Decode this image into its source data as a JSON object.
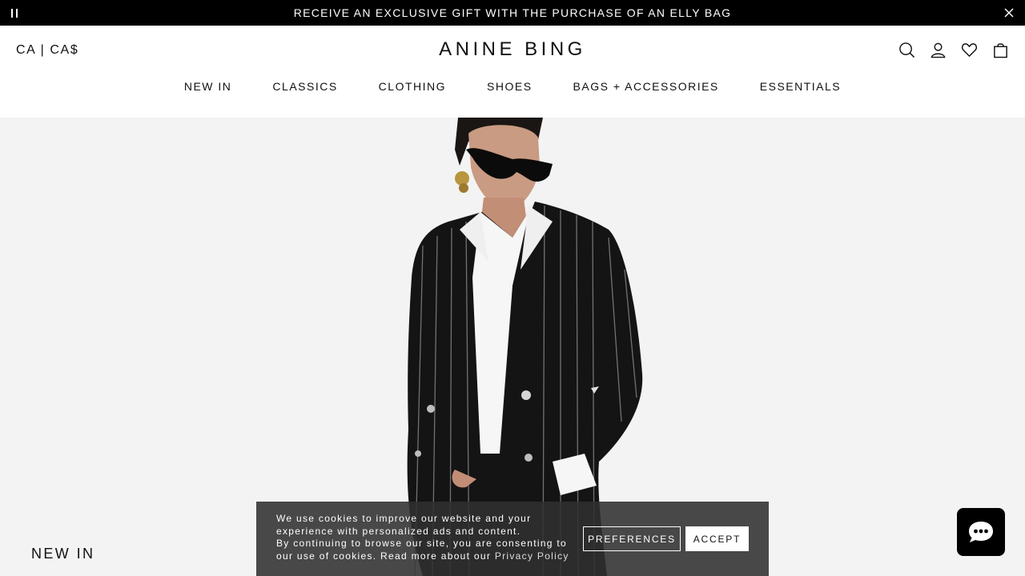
{
  "announcement": {
    "message": "RECEIVE AN EXCLUSIVE GIFT WITH THE PURCHASE OF AN ELLY BAG",
    "pause_icon": "pause-icon",
    "close_icon": "close-icon"
  },
  "header": {
    "locale": "CA | CA$",
    "logo": "ANINE BING",
    "icons": [
      "search-icon",
      "account-icon",
      "wishlist-heart-icon",
      "shopping-bag-icon"
    ]
  },
  "nav": {
    "items": [
      {
        "label": "NEW IN"
      },
      {
        "label": "CLASSICS"
      },
      {
        "label": "CLOTHING"
      },
      {
        "label": "SHOES"
      },
      {
        "label": "BAGS + ACCESSORIES"
      },
      {
        "label": "ESSENTIALS"
      }
    ]
  },
  "hero": {
    "title": "NEW IN",
    "background": "#f3f3f3"
  },
  "cookie": {
    "line1": "We use cookies to improve our website and your",
    "line2": "experience with personalized ads and content.",
    "line3": "By continuing to browse our site, you are consenting to",
    "line4": "our use of cookies. Read more about our",
    "link": "Privacy Policy",
    "preferences": "PREFERENCES",
    "accept": "ACCEPT"
  },
  "chat": {
    "icon": "chat-bubble-icon"
  },
  "colors": {
    "announcement_bg": "#000000",
    "text": "#111111",
    "cookie_bg": "#303030"
  }
}
